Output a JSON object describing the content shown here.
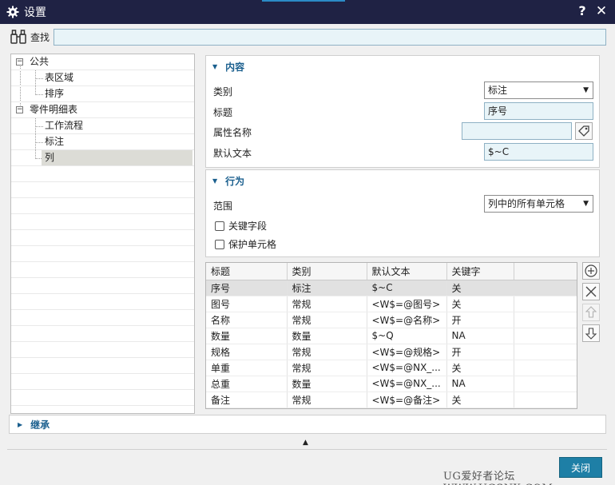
{
  "window": {
    "title": "设置",
    "help_glyph": "?",
    "close_glyph": "✕"
  },
  "search": {
    "label": "查找",
    "value": ""
  },
  "tree": [
    {
      "label": "公共",
      "level": 0,
      "expander": "−"
    },
    {
      "label": "表区域",
      "level": 1
    },
    {
      "label": "排序",
      "level": 1
    },
    {
      "label": "零件明细表",
      "level": 0,
      "expander": "−"
    },
    {
      "label": "工作流程",
      "level": 1
    },
    {
      "label": "标注",
      "level": 1
    },
    {
      "label": "列",
      "level": 1,
      "selected": true
    }
  ],
  "content_section": {
    "title": "内容",
    "category_label": "类别",
    "category_value": "标注",
    "heading_label": "标题",
    "heading_value": "序号",
    "attribute_label": "属性名称",
    "attribute_value": "",
    "default_text_label": "默认文本",
    "default_text_value": "$~C"
  },
  "behavior_section": {
    "title": "行为",
    "scope_label": "范围",
    "scope_value": "列中的所有单元格",
    "key_field_label": "关键字段",
    "key_field_checked": false,
    "protect_cell_label": "保护单元格",
    "protect_cell_checked": false
  },
  "columns_table": {
    "headers": [
      "标题",
      "类别",
      "默认文本",
      "关键字"
    ],
    "rows": [
      [
        "序号",
        "标注",
        "$~C",
        "关"
      ],
      [
        "图号",
        "常规",
        "<W$=@图号>",
        "关"
      ],
      [
        "名称",
        "常规",
        "<W$=@名称>",
        "开"
      ],
      [
        "数量",
        "数量",
        "$~Q",
        "NA"
      ],
      [
        "规格",
        "常规",
        "<W$=@规格>",
        "开"
      ],
      [
        "单重",
        "常规",
        "<W$=@NX_...",
        "关"
      ],
      [
        "总重",
        "数量",
        "<W$=@NX_...",
        "NA"
      ],
      [
        "备注",
        "常规",
        "<W$=@备注>",
        "关"
      ]
    ],
    "selected_row": 0
  },
  "inherit_section": {
    "title": "继承"
  },
  "footer": {
    "close_label": "关闭",
    "watermark": "UG爱好者论坛 WWW.UGSNX.COM"
  },
  "colors": {
    "titlebar": "#1f2244",
    "accent": "#1e7fa6",
    "section_title": "#1a5f8e",
    "field_bg": "#e8f4f8"
  }
}
